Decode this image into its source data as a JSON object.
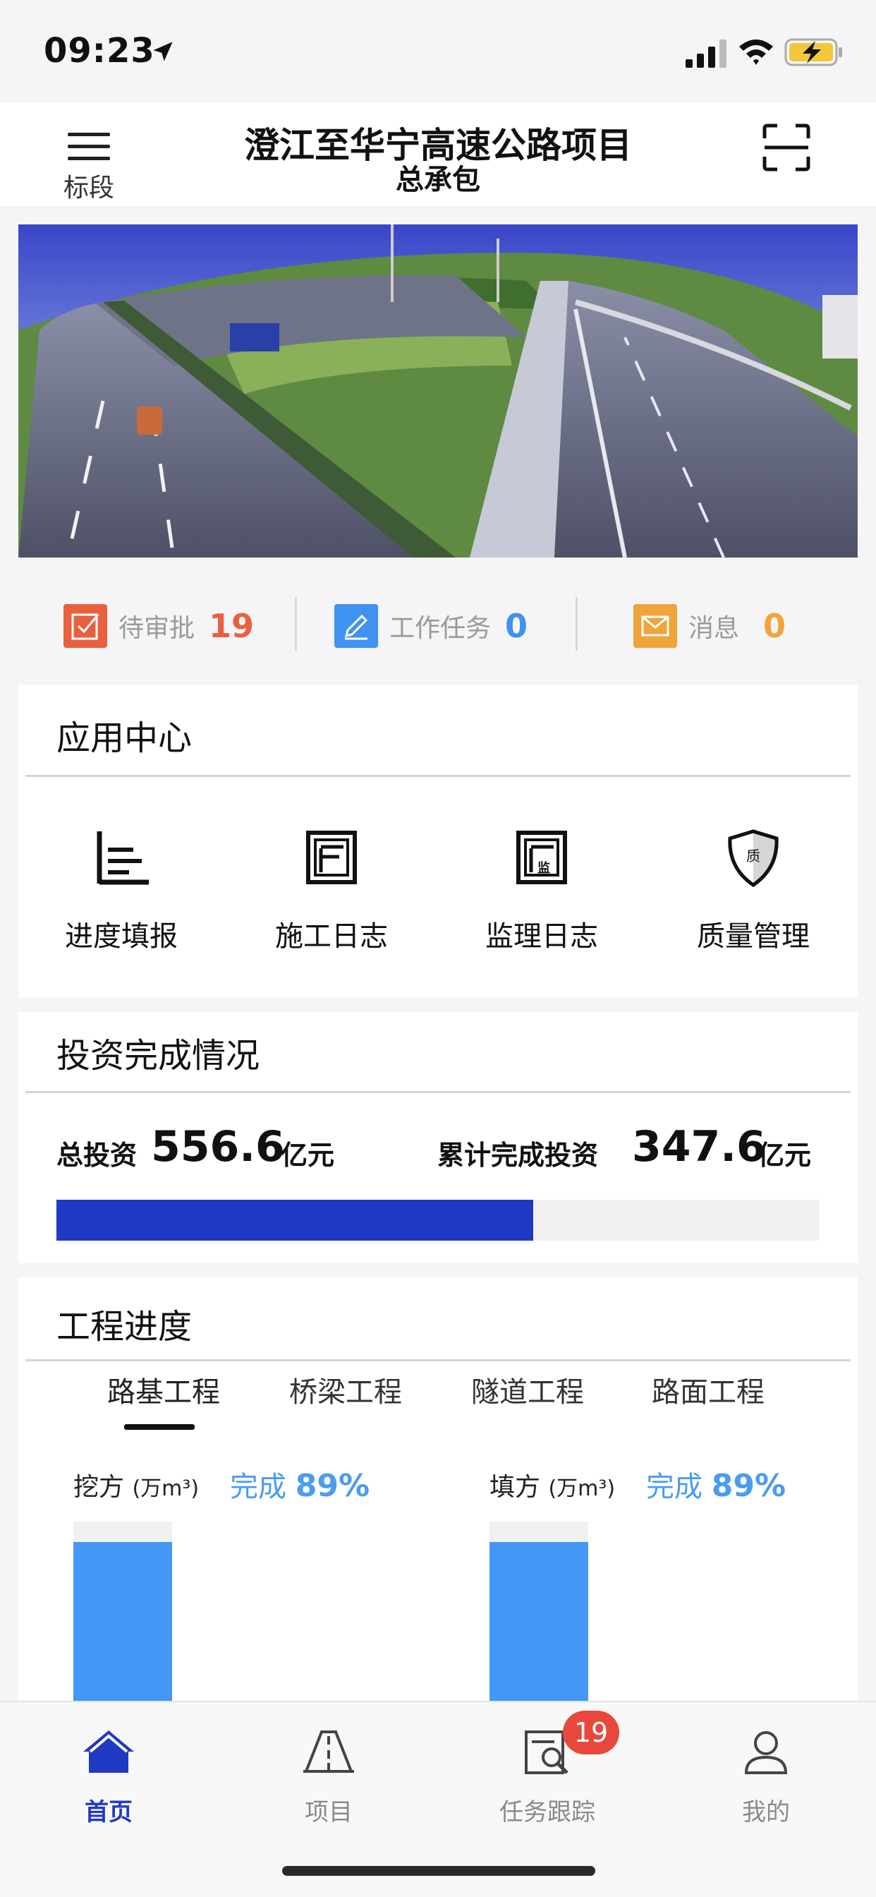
{
  "status_bar": {
    "time": "09:23"
  },
  "header": {
    "menu_label": "标段",
    "title": "澄江至华宁高速公路项目",
    "subtitle": "总承包"
  },
  "counters": [
    {
      "label": "待审批",
      "count": "19",
      "color": "#e8613f"
    },
    {
      "label": "工作任务",
      "count": "0",
      "color": "#3f92ef"
    },
    {
      "label": "消息",
      "count": "0",
      "color": "#f0a43a"
    }
  ],
  "app_center": {
    "title": "应用中心",
    "items": [
      {
        "label": "进度填报",
        "icon": "progress-report-icon"
      },
      {
        "label": "施工日志",
        "icon": "construction-log-icon"
      },
      {
        "label": "监理日志",
        "icon": "supervision-log-icon",
        "icon_text": "监"
      },
      {
        "label": "质量管理",
        "icon": "quality-shield-icon",
        "icon_text": "质"
      }
    ]
  },
  "investment": {
    "title": "投资完成情况",
    "total_label": "总投资",
    "total_value": "556.6",
    "total_unit": "亿元",
    "done_label": "累计完成投资",
    "done_value": "347.6",
    "done_unit": "亿元",
    "progress_fraction": 0.6245,
    "bar_color": "#2039c2"
  },
  "engineering": {
    "title": "工程进度",
    "tabs": [
      "路基工程",
      "桥梁工程",
      "隧道工程",
      "路面工程"
    ],
    "active_tab": 0,
    "metrics": [
      {
        "label": "挖方",
        "unit": "(万m³)",
        "done_label": "完成",
        "done_value": "89%",
        "fraction": 0.89
      },
      {
        "label": "填方",
        "unit": "(万m³)",
        "done_label": "完成",
        "done_value": "89%",
        "fraction": 0.89
      }
    ]
  },
  "bottom_nav": {
    "items": [
      {
        "label": "首页",
        "icon": "home-icon",
        "active": true
      },
      {
        "label": "项目",
        "icon": "road-icon",
        "active": false
      },
      {
        "label": "任务跟踪",
        "icon": "task-tracking-icon",
        "active": false
      },
      {
        "label": "我的",
        "icon": "user-icon",
        "active": false
      }
    ],
    "badge": "19"
  }
}
